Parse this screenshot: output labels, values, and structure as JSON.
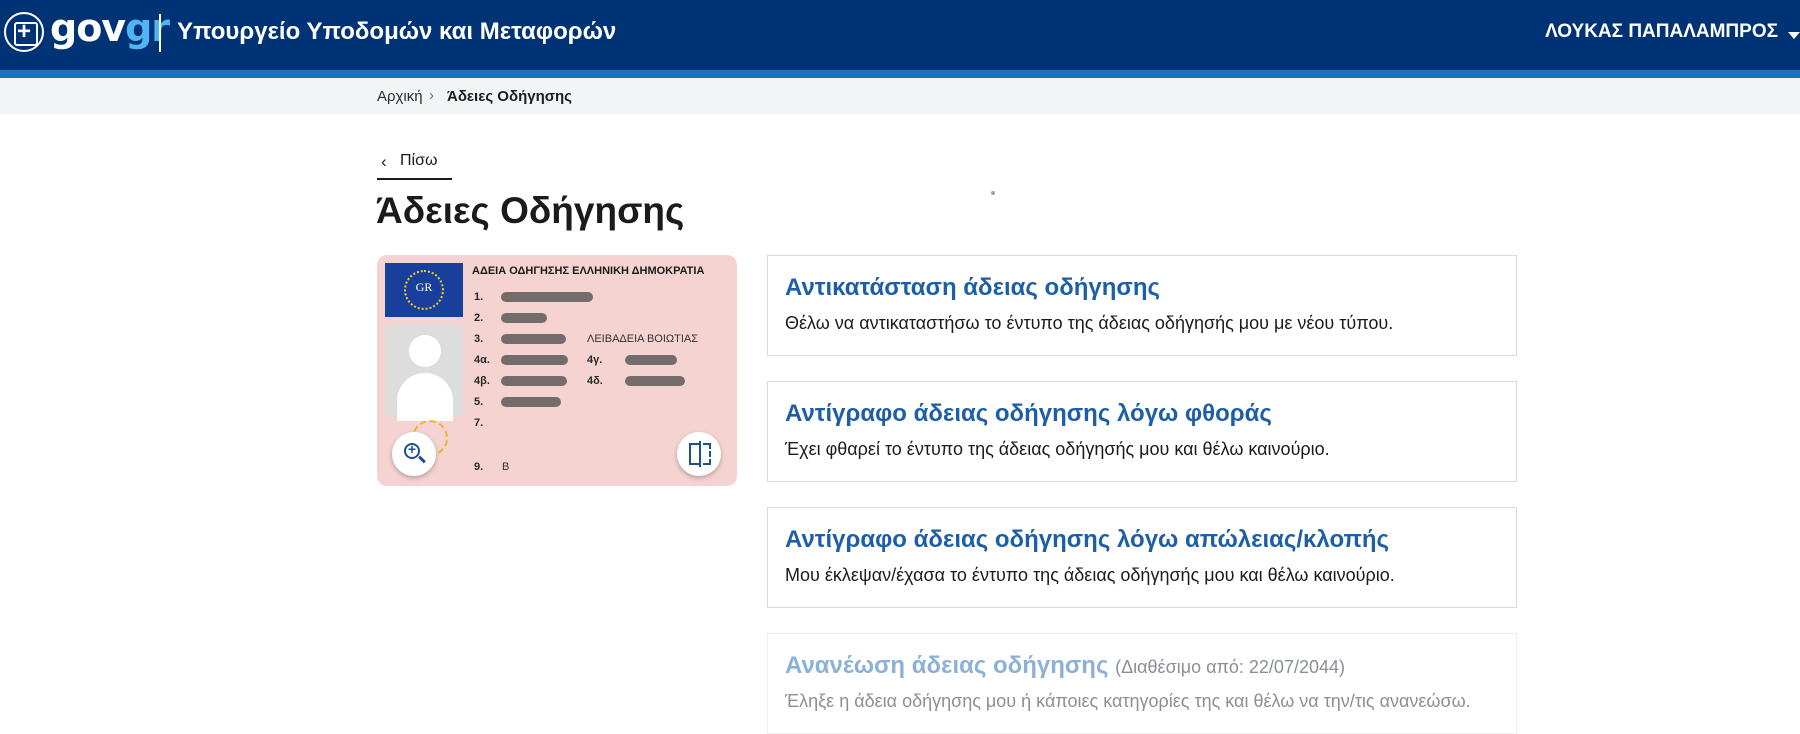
{
  "header": {
    "logo_main": "gov",
    "logo_accent": "gr",
    "ministry": "Υπουργείο Υποδομών και Μεταφορών",
    "user_name": "ΛΟΥΚΑΣ ΠΑΠΑΛΑΜΠΡΟΣ",
    "brand_color": "#003375",
    "stripe_color": "#1d6fc4"
  },
  "breadcrumb": {
    "home": "Αρχική",
    "separator": "›",
    "current": "Άδειες Οδήγησης"
  },
  "back": {
    "label": "Πίσω",
    "icon": "chevron-left-icon"
  },
  "page": {
    "title": "Άδειες Οδήγησης"
  },
  "license_card": {
    "country_code": "GR",
    "header": "ΑΔΕΙΑ ΟΔΗΓΗΣΗΣ ΕΛΛΗΝΙΚΗ ΔΗΜΟΚΡΑΤΙΑ",
    "fields": {
      "f1": "1.",
      "f2": "2.",
      "f3": "3.",
      "f3_place": "ΛΕΙΒΑΔΕΙΑ ΒΟΙΩΤΙΑΣ",
      "f4a": "4α.",
      "f4g": "4γ.",
      "f4b": "4β.",
      "f4d": "4δ.",
      "f5": "5.",
      "f7": "7.",
      "f9": "9.",
      "f9_value": "B"
    },
    "card_color": "#f4d3d0",
    "zoom_icon": "zoom-in-icon",
    "flip_icon": "flip-card-icon"
  },
  "services": [
    {
      "title": "Αντικατάσταση άδειας οδήγησης",
      "description": "Θέλω να αντικαταστήσω το έντυπο της άδειας οδήγησής μου με νέου τύπου.",
      "enabled": true
    },
    {
      "title": "Αντίγραφο άδειας οδήγησης λόγω φθοράς",
      "description": "Έχει φθαρεί το έντυπο της άδειας οδήγησής μου και θέλω καινούριο.",
      "enabled": true
    },
    {
      "title": "Αντίγραφο άδειας οδήγησης λόγω απώλειας/κλοπής",
      "description": "Μου έκλεψαν/έχασα το έντυπο της άδειας οδήγησής μου και θέλω καινούριο.",
      "enabled": true
    },
    {
      "title": "Ανανέωση άδειας οδήγησης",
      "note": "(Διαθέσιμο από: 22/07/2044)",
      "description": "Έληξε η άδεια οδήγησης μου ή κάποιες κατηγορίες της και θέλω να την/τις ανανεώσω.",
      "enabled": false
    }
  ],
  "link_color": "#1d5fa7"
}
